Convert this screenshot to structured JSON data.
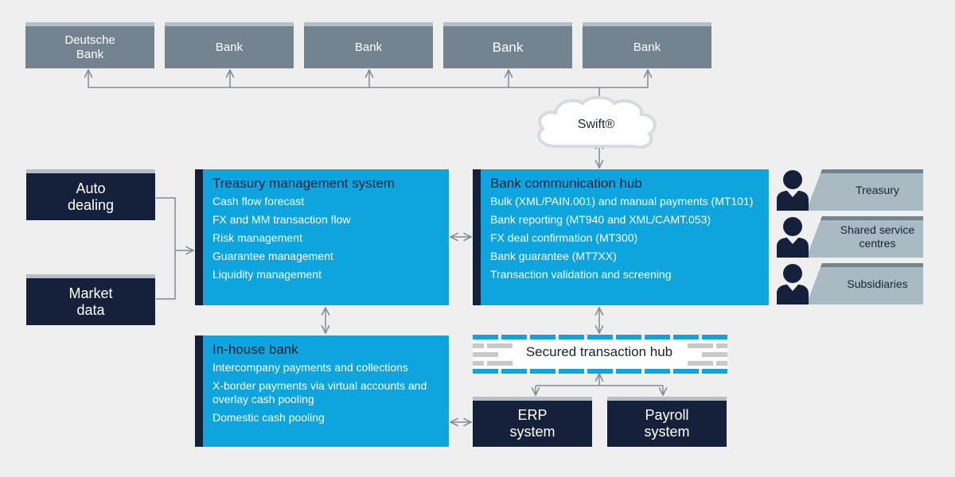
{
  "banks": [
    {
      "label": "Deutsche Bank"
    },
    {
      "label": "Bank"
    },
    {
      "label": "Bank"
    },
    {
      "label": "Bank"
    },
    {
      "label": "Bank"
    }
  ],
  "network": {
    "label": "Swift®",
    "icon": "cloud-icon"
  },
  "inputs": [
    {
      "label": "Auto dealing"
    },
    {
      "label": "Market data"
    }
  ],
  "treasury_management_system": {
    "title": "Treasury management system",
    "items": [
      "Cash flow forecast",
      "FX and MM transaction flow",
      "Risk management",
      "Guarantee management",
      "Liquidity management"
    ]
  },
  "bank_communication_hub": {
    "title": "Bank communication hub",
    "items": [
      "Bulk (XML/PAIN.001) and manual payments (MT101)",
      "Bank reporting (MT940 and XML/CAMT.053)",
      "FX deal confirmation (MT300)",
      "Bank guarantee (MT7XX)",
      "Transaction validation and screening"
    ]
  },
  "in_house_bank": {
    "title": "In-house bank",
    "items": [
      "Intercompany payments and collections",
      "X-border payments via virtual accounts and overlay cash pooling",
      "Domestic cash pooling"
    ]
  },
  "secured_transaction_hub": {
    "label": "Secured transaction hub"
  },
  "systems": [
    {
      "label": "ERP system"
    },
    {
      "label": "Payroll system"
    }
  ],
  "users": [
    {
      "label": "Treasury",
      "icon": "person-icon"
    },
    {
      "label": "Shared service centres",
      "icon": "person-icon"
    },
    {
      "label": "Subsidiaries",
      "icon": "person-icon"
    }
  ],
  "colors": {
    "background": "#efefef",
    "bank_box": "#73838f",
    "accent_top": "#b3c0c8",
    "dark_box": "#15213b",
    "blue_box": "#0ea5de",
    "connector": "#7d8c97"
  }
}
